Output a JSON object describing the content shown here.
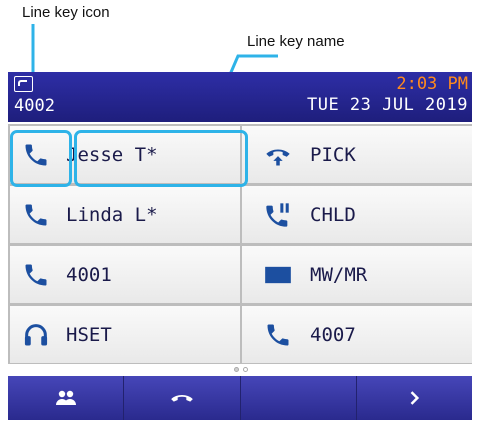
{
  "annotations": {
    "line_key_icon": "Line key icon",
    "line_key_name": "Line key name"
  },
  "header": {
    "extension": "4002",
    "time": "2:03 PM",
    "date": "TUE 23 JUL 2019"
  },
  "line_keys": [
    {
      "icon": "handset-icon",
      "label": "Jesse T*"
    },
    {
      "icon": "pickup-icon",
      "label": "PICK"
    },
    {
      "icon": "handset-icon",
      "label": "Linda L*"
    },
    {
      "icon": "call-hold-icon",
      "label": "CHLD"
    },
    {
      "icon": "handset-icon",
      "label": "4001"
    },
    {
      "icon": "message-waiting-icon",
      "label": "MW/MR"
    },
    {
      "icon": "headset-icon",
      "label": "HSET"
    },
    {
      "icon": "handset-icon",
      "label": "4007"
    }
  ],
  "page_indicator": {
    "pages": 2,
    "current": 2
  },
  "soft_keys": [
    {
      "icon": "contacts-icon"
    },
    {
      "icon": "hang-up-icon"
    },
    {
      "icon": "blank"
    },
    {
      "icon": "chevron-right-icon"
    }
  ],
  "colors": {
    "header_bg": "#1e1e7c",
    "time_text": "#ff8a1e",
    "icon_blue": "#1c4fa0",
    "highlight": "#2eb3e8",
    "softkey_bg": "#2a2a8e"
  }
}
